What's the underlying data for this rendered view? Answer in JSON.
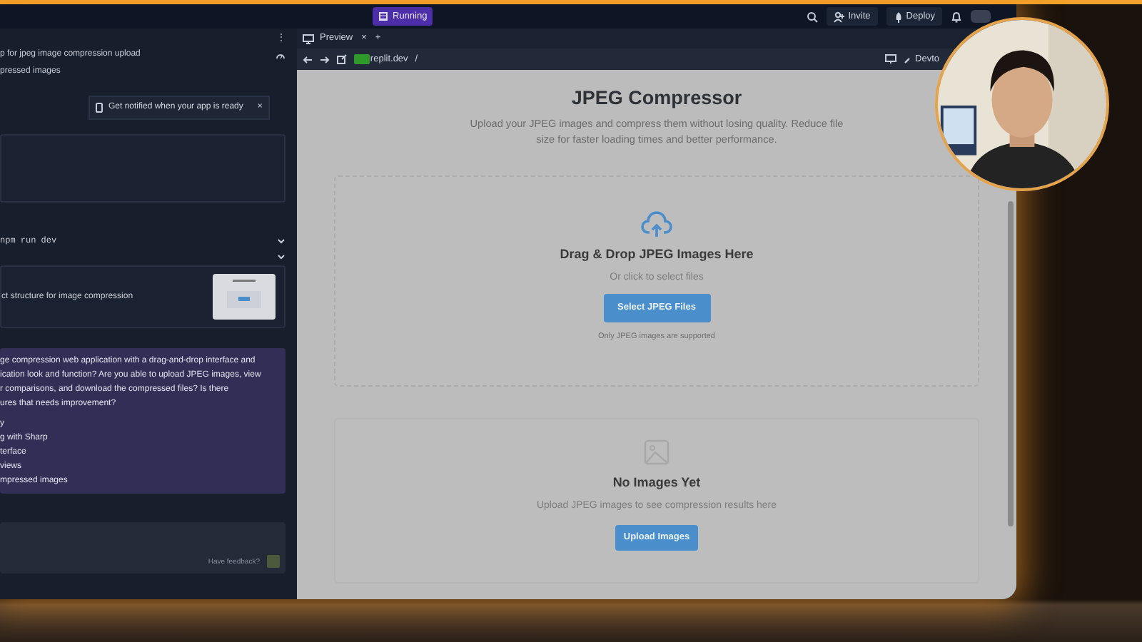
{
  "top_bar": {
    "status": "Running",
    "buttons": [
      {
        "label": "Invite",
        "kind": "invite"
      },
      {
        "label": "Deploy",
        "kind": "deploy"
      }
    ]
  },
  "chat": {
    "menu": "⋮",
    "task_title": "p for jpeg image compression upload",
    "task_subtitle": "pressed images",
    "notice": {
      "text": "Get notified when your app is ready",
      "close": "×"
    },
    "command": "npm run dev",
    "checkpoint": "ct structure for image compression",
    "message": {
      "lines": [
        "ge compression web application with a drag-and-drop interface and",
        "ication look and function? Are you able to upload JPEG images, view",
        "r comparisons, and download the compressed files? Is there",
        "ures that needs improvement?"
      ],
      "items": [
        "y",
        "g with Sharp",
        "terface",
        "views",
        "mpressed images"
      ]
    },
    "feedback": "Have feedback?"
  },
  "preview": {
    "tab": "Preview",
    "tab_close": "×",
    "new_tab": "+",
    "url_host": "replit.dev",
    "url_path": "/",
    "devtools": "Devto",
    "app": {
      "title": "JPEG Compressor",
      "subtitle": "Upload your JPEG images and compress them without losing quality. Reduce file size for faster loading times and better performance.",
      "dropzone": {
        "heading": "Drag & Drop JPEG Images Here",
        "hint": "Or click to select files",
        "button": "Select JPEG Files",
        "note": "Only JPEG images are supported"
      },
      "results": {
        "heading": "No Images Yet",
        "hint": "Upload JPEG images to see compression results here",
        "button": "Upload Images"
      }
    }
  }
}
